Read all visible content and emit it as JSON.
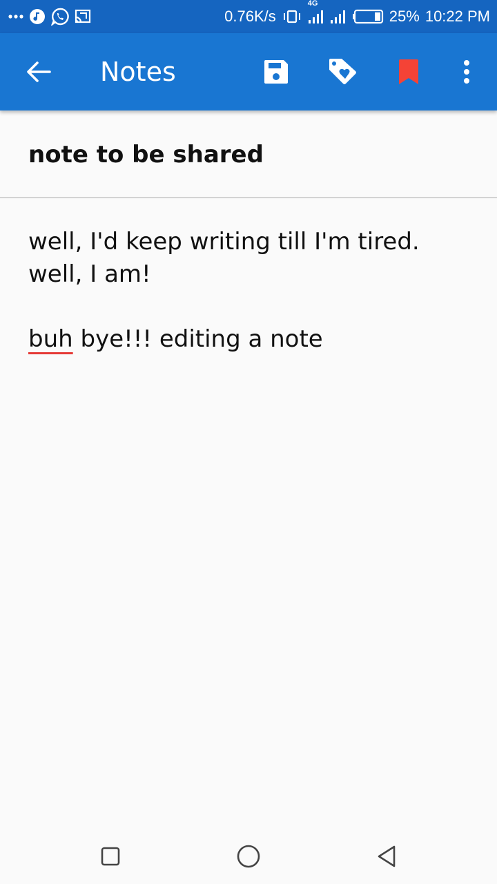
{
  "status_bar": {
    "net_speed": "0.76K/s",
    "network_type": "4G",
    "battery": "25%",
    "time": "10:22 PM",
    "icons": [
      "more-dots-icon",
      "music-icon",
      "whatsapp-icon",
      "cast-icon",
      "vibrate-icon",
      "signal-icon",
      "signal-icon",
      "battery-icon"
    ]
  },
  "app_bar": {
    "title": "Notes",
    "icons": [
      "back-arrow-icon",
      "save-icon",
      "tag-heart-icon",
      "bookmark-icon",
      "more-vert-icon"
    ]
  },
  "note": {
    "title": "note to be shared",
    "body_line1": "well, I'd keep writing till I'm tired.",
    "body_line2": "well, I am!",
    "body_misspelled": "buh",
    "body_line3_rest": " bye!!! editing a note"
  },
  "nav_bar": {
    "icons": [
      "recents-square-icon",
      "home-circle-icon",
      "back-triangle-icon"
    ]
  },
  "colors": {
    "status_bar": "#1565c0",
    "app_bar": "#1976d2",
    "bookmark": "#f44336",
    "background": "#fafafa"
  }
}
